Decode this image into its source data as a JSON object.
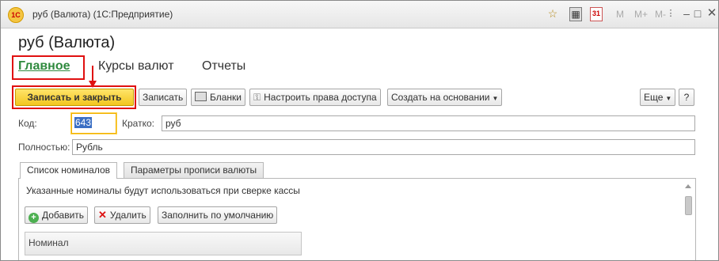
{
  "window": {
    "title": "руб (Валюта)  (1С:Предприятие)",
    "logo_text": "1С",
    "icons": [
      "favorite-star-icon",
      "calculator-icon",
      "calendar-icon"
    ],
    "calendar_badge": "31",
    "memory_buttons": [
      "M",
      "M+",
      "M-"
    ],
    "controls": [
      "more-icon",
      "minimize-icon",
      "maximize-icon",
      "close-icon"
    ]
  },
  "form": {
    "title": "руб (Валюта)"
  },
  "nav": {
    "items": [
      "Главное",
      "Курсы валют",
      "Отчеты"
    ],
    "active": "Главное"
  },
  "toolbar": {
    "save_close": "Записать и закрыть",
    "save": "Записать",
    "forms": "Бланки",
    "access_rights": "Настроить права доступа",
    "create_based_on": "Создать на основании",
    "more": "Еще",
    "help": "?"
  },
  "fields": {
    "code_label": "Код:",
    "code_value": "643",
    "short_label": "Кратко:",
    "short_value": "руб",
    "full_label": "Полностью:",
    "full_value": "Рубль"
  },
  "tabs": {
    "items": [
      "Список номиналов",
      "Параметры прописи валюты"
    ],
    "active": "Список номиналов"
  },
  "denominations": {
    "info": "Указанные номиналы будут использоваться при сверке кассы",
    "add": "Добавить",
    "delete": "Удалить",
    "fill_default": "Заполнить по умолчанию",
    "columns": [
      "Номинал"
    ]
  },
  "colors": {
    "accent_green": "#2f8a3e",
    "highlight_red": "#e01010",
    "primary_button": "#f2c61f"
  }
}
